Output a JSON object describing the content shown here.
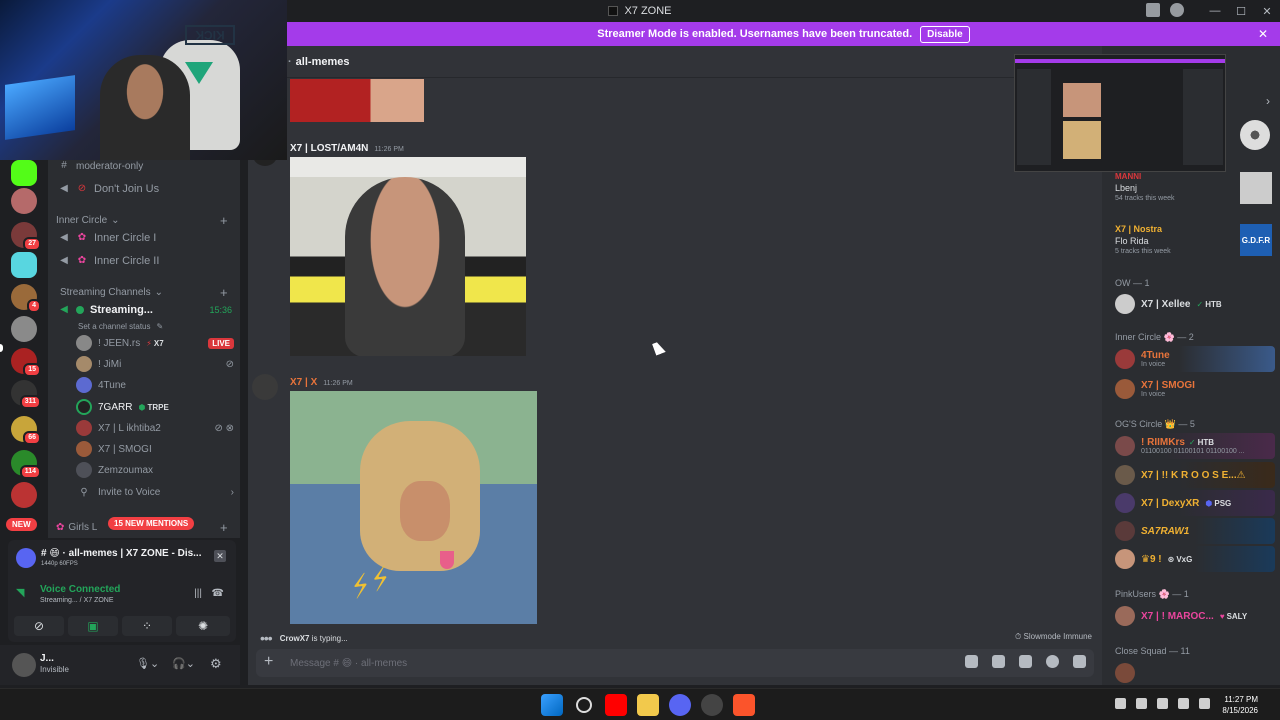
{
  "app": {
    "title": "X7 ZONE"
  },
  "banner": {
    "text": "Streamer Mode is enabled. Usernames have been truncated.",
    "disable_label": "Disable",
    "close": "✕"
  },
  "webcam_sign": "KICK",
  "rail": {
    "badges": [
      "27",
      "4",
      "15",
      "311",
      "66",
      "114"
    ],
    "new_label": "NEW"
  },
  "channels": {
    "items": [
      {
        "label": "moderator-only"
      },
      {
        "label": "Don't Join Us"
      }
    ],
    "inner_circle": {
      "category": "Inner Circle",
      "items": [
        "Inner Circle I",
        "Inner Circle II"
      ]
    },
    "streaming": {
      "category": "Streaming Channels",
      "channel": "Streaming...",
      "time": "15:36",
      "status_placeholder": "Set a channel status",
      "users": [
        {
          "name": "! JEEN.rs",
          "tag": "X7",
          "live": "LIVE"
        },
        {
          "name": "! JiMi"
        },
        {
          "name": "4Tune"
        },
        {
          "name": "7GARR",
          "tag": "TRPE"
        },
        {
          "name": "X7 | L ikhtiba2"
        },
        {
          "name": "X7 | SMOGI"
        },
        {
          "name": "Zemzoumax"
        }
      ],
      "invite": "Invite to Voice"
    },
    "girls_partial": "Girls L",
    "mentions_label": "15 NEW MENTIONS"
  },
  "stream_panel": {
    "title": "# 😄 · all-memes | X7 ZONE - Dis...",
    "quality": "1440p 60FPS"
  },
  "voice": {
    "status": "Voice Connected",
    "channel": "Streaming... / X7 ZONE"
  },
  "user": {
    "name": "J...",
    "status": "Invisible"
  },
  "chat": {
    "channel_name": "all-memes",
    "messages": [
      {
        "author": "X7 | LOST/AM4N",
        "time": "11:26 PM",
        "author_color": "#f2f3f5"
      },
      {
        "author": "X7 | X",
        "time": "11:26 PM",
        "author_color": "#e8743b"
      }
    ],
    "typing_user": "CrowX7",
    "typing_suffix": "is typing...",
    "slowmode": "Slowmode Immune",
    "composer_placeholder": "Message # 😄 · all-memes"
  },
  "members": {
    "music": [
      {
        "name": "MANNI",
        "song": "Lbenj",
        "tracks": "54 tracks this week"
      },
      {
        "name": "X7 | Nostra",
        "song": "Flo Rida",
        "tracks": "5 tracks this week",
        "art": "G.D.F.R"
      }
    ],
    "groups": [
      {
        "label": "OW — 1",
        "members": [
          {
            "name": "X7 | Xellee",
            "tag": "HTB",
            "color": "#dbdee1"
          }
        ]
      },
      {
        "label": "Inner Circle 🌸 — 2",
        "members": [
          {
            "name": "4Tune",
            "sub": "In voice",
            "color": "#e8743b"
          },
          {
            "name": "X7 | SMOGI",
            "sub": "In voice",
            "color": "#e8743b"
          }
        ]
      },
      {
        "label": "OG'S Circle 👑 — 5",
        "members": [
          {
            "name": "! RIIMKrs",
            "tag": "HTB",
            "sub": "01100100 01100101 01100100 ...",
            "color": "#e8743b"
          },
          {
            "name": "X7 | !! K R O O S E...⚠",
            "color": "#f0b132"
          },
          {
            "name": "X7 | DexyXR",
            "tag": "PSG",
            "color": "#f0b132"
          },
          {
            "name": "SA7RAW1",
            "color": "#f0b132"
          },
          {
            "name": "♛9 !",
            "tag": "VxG",
            "color": "#f0b132"
          }
        ]
      },
      {
        "label": "PinkUsers 🌸 — 1",
        "members": [
          {
            "name": "X7 | ! MAROC...",
            "tag": "SALY",
            "color": "#eb459e"
          }
        ]
      },
      {
        "label": "Close Squad — 11",
        "members": [
          {
            "name": "",
            "color": "#da373c"
          }
        ]
      }
    ]
  },
  "taskbar": {
    "time": "11:27 PM",
    "date": "8/15/2026"
  },
  "colors": {
    "accent": "#a43bea",
    "live": "#da373c",
    "online": "#23a55a",
    "bg": "#313338"
  }
}
